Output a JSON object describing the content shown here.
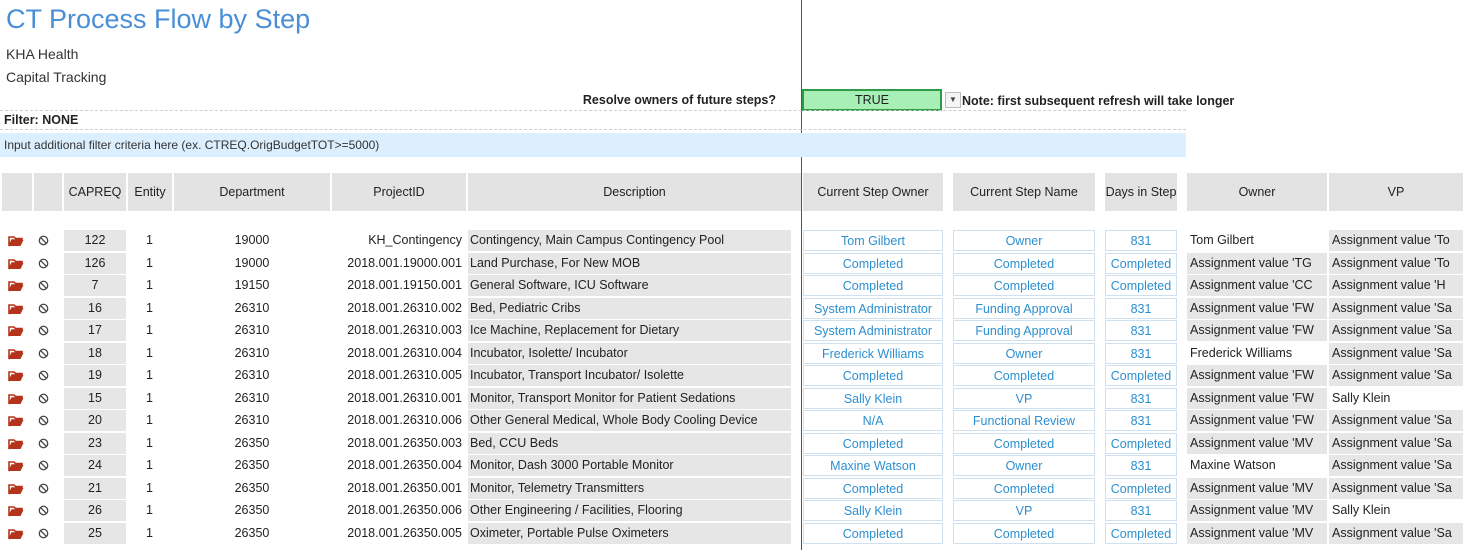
{
  "header": {
    "title": "CT Process Flow by Step",
    "org": "KHA Health",
    "app": "Capital Tracking"
  },
  "options": {
    "resolve_label": "Resolve owners of future steps?",
    "resolve_value": "TRUE",
    "note": "Note: first subsequent refresh will take longer",
    "filter": "Filter: NONE",
    "criteria_placeholder": "Input additional filter criteria here (ex. CTREQ.OrigBudgetTOT>=5000)"
  },
  "columns": {
    "capreq": "CAPREQ",
    "entity": "Entity",
    "department": "Department",
    "projectid": "ProjectID",
    "description": "Description",
    "owner_current": "Current Step Owner",
    "step_name": "Current Step Name",
    "days": "Days in Step",
    "owner": "Owner",
    "vp": "VP"
  },
  "colors": {
    "accent": "#2c8fd0",
    "title": "#4a8fd6",
    "true_fill": "#a8efb6",
    "criteria_bg": "#dcefff",
    "folder": "#b5331a"
  },
  "rows": [
    {
      "capreq": "122",
      "entity": "1",
      "dept": "19000",
      "pid": "KH_Contingency",
      "desc": "Contingency, Main Campus Contingency Pool",
      "cso": "Tom Gilbert",
      "csn": "Owner",
      "days": "831",
      "owner": "Tom Gilbert",
      "vp": "Assignment value 'To"
    },
    {
      "capreq": "126",
      "entity": "1",
      "dept": "19000",
      "pid": "2018.001.19000.001",
      "desc": "Land Purchase, For New MOB",
      "cso": "Completed",
      "csn": "Completed",
      "days": "Completed",
      "owner": "Assignment value 'TG",
      "vp": "Assignment value 'To"
    },
    {
      "capreq": "7",
      "entity": "1",
      "dept": "19150",
      "pid": "2018.001.19150.001",
      "desc": "General Software, ICU Software",
      "cso": "Completed",
      "csn": "Completed",
      "days": "Completed",
      "owner": "Assignment value 'CC",
      "vp": "Assignment value 'H"
    },
    {
      "capreq": "16",
      "entity": "1",
      "dept": "26310",
      "pid": "2018.001.26310.002",
      "desc": "Bed, Pediatric Cribs",
      "cso": "System Administrator",
      "csn": "Funding Approval",
      "days": "831",
      "owner": "Assignment value 'FW",
      "vp": "Assignment value 'Sa"
    },
    {
      "capreq": "17",
      "entity": "1",
      "dept": "26310",
      "pid": "2018.001.26310.003",
      "desc": "Ice Machine, Replacement for Dietary",
      "cso": "System Administrator",
      "csn": "Funding Approval",
      "days": "831",
      "owner": "Assignment value 'FW",
      "vp": "Assignment value 'Sa"
    },
    {
      "capreq": "18",
      "entity": "1",
      "dept": "26310",
      "pid": "2018.001.26310.004",
      "desc": "Incubator, Isolette/ Incubator",
      "cso": "Frederick Williams",
      "csn": "Owner",
      "days": "831",
      "owner": "Frederick Williams",
      "vp": "Assignment value 'Sa"
    },
    {
      "capreq": "19",
      "entity": "1",
      "dept": "26310",
      "pid": "2018.001.26310.005",
      "desc": "Incubator, Transport Incubator/ Isolette",
      "cso": "Completed",
      "csn": "Completed",
      "days": "Completed",
      "owner": "Assignment value 'FW",
      "vp": "Assignment value 'Sa"
    },
    {
      "capreq": "15",
      "entity": "1",
      "dept": "26310",
      "pid": "2018.001.26310.001",
      "desc": "Monitor, Transport Monitor for Patient Sedations",
      "cso": "Sally Klein",
      "csn": "VP",
      "days": "831",
      "owner": "Assignment value 'FW",
      "vp": "Sally Klein"
    },
    {
      "capreq": "20",
      "entity": "1",
      "dept": "26310",
      "pid": "2018.001.26310.006",
      "desc": "Other General Medical, Whole Body Cooling Device",
      "cso": "N/A",
      "csn": "Functional Review",
      "days": "831",
      "owner": "Assignment value 'FW",
      "vp": "Assignment value 'Sa"
    },
    {
      "capreq": "23",
      "entity": "1",
      "dept": "26350",
      "pid": "2018.001.26350.003",
      "desc": "Bed, CCU Beds",
      "cso": "Completed",
      "csn": "Completed",
      "days": "Completed",
      "owner": "Assignment value 'MV",
      "vp": "Assignment value 'Sa"
    },
    {
      "capreq": "24",
      "entity": "1",
      "dept": "26350",
      "pid": "2018.001.26350.004",
      "desc": "Monitor, Dash 3000 Portable Monitor",
      "cso": "Maxine Watson",
      "csn": "Owner",
      "days": "831",
      "owner": "Maxine Watson",
      "vp": "Assignment value 'Sa"
    },
    {
      "capreq": "21",
      "entity": "1",
      "dept": "26350",
      "pid": "2018.001.26350.001",
      "desc": "Monitor, Telemetry Transmitters",
      "cso": "Completed",
      "csn": "Completed",
      "days": "Completed",
      "owner": "Assignment value 'MV",
      "vp": "Assignment value 'Sa"
    },
    {
      "capreq": "26",
      "entity": "1",
      "dept": "26350",
      "pid": "2018.001.26350.006",
      "desc": "Other Engineering / Facilities, Flooring",
      "cso": "Sally Klein",
      "csn": "VP",
      "days": "831",
      "owner": "Assignment value 'MV",
      "vp": "Sally Klein"
    },
    {
      "capreq": "25",
      "entity": "1",
      "dept": "26350",
      "pid": "2018.001.26350.005",
      "desc": "Oximeter, Portable Pulse Oximeters",
      "cso": "Completed",
      "csn": "Completed",
      "days": "Completed",
      "owner": "Assignment value 'MV",
      "vp": "Assignment value 'Sa"
    }
  ]
}
